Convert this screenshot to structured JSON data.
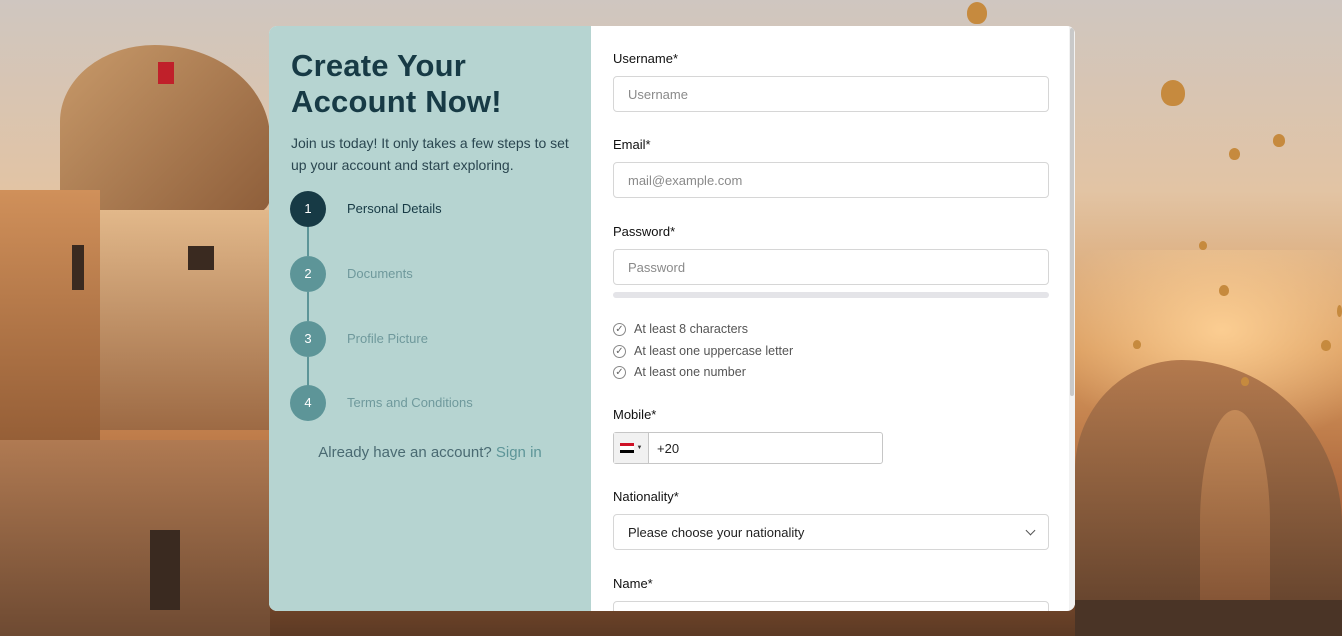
{
  "left_panel": {
    "title_line1": "Create Your",
    "title_line2": "Account Now!",
    "subtitle": "Join us today! It only takes a few steps to set up your account and start exploring.",
    "steps": [
      {
        "number": "1",
        "label": "Personal Details",
        "active": true
      },
      {
        "number": "2",
        "label": "Documents",
        "active": false
      },
      {
        "number": "3",
        "label": "Profile Picture",
        "active": false
      },
      {
        "number": "4",
        "label": "Terms and Conditions",
        "active": false
      }
    ],
    "signin_prompt": "Already have an account?",
    "signin_link": "Sign in"
  },
  "form": {
    "username": {
      "label": "Username*",
      "placeholder": "Username",
      "value": ""
    },
    "email": {
      "label": "Email*",
      "placeholder": "mail@example.com",
      "value": ""
    },
    "password": {
      "label": "Password*",
      "placeholder": "Password",
      "value": "",
      "strength": 0
    },
    "password_rules": [
      "At least 8 characters",
      "At least one uppercase letter",
      "At least one number"
    ],
    "mobile": {
      "label": "Mobile*",
      "value": "+20",
      "country_icon": "egypt-flag-icon"
    },
    "nationality": {
      "label": "Nationality*",
      "selected": "Please choose your nationality"
    },
    "name": {
      "label": "Name*"
    }
  },
  "colors": {
    "panel_bg": "#b6d4d1",
    "primary_dark": "#173a45",
    "step_inactive": "#5d9598"
  }
}
